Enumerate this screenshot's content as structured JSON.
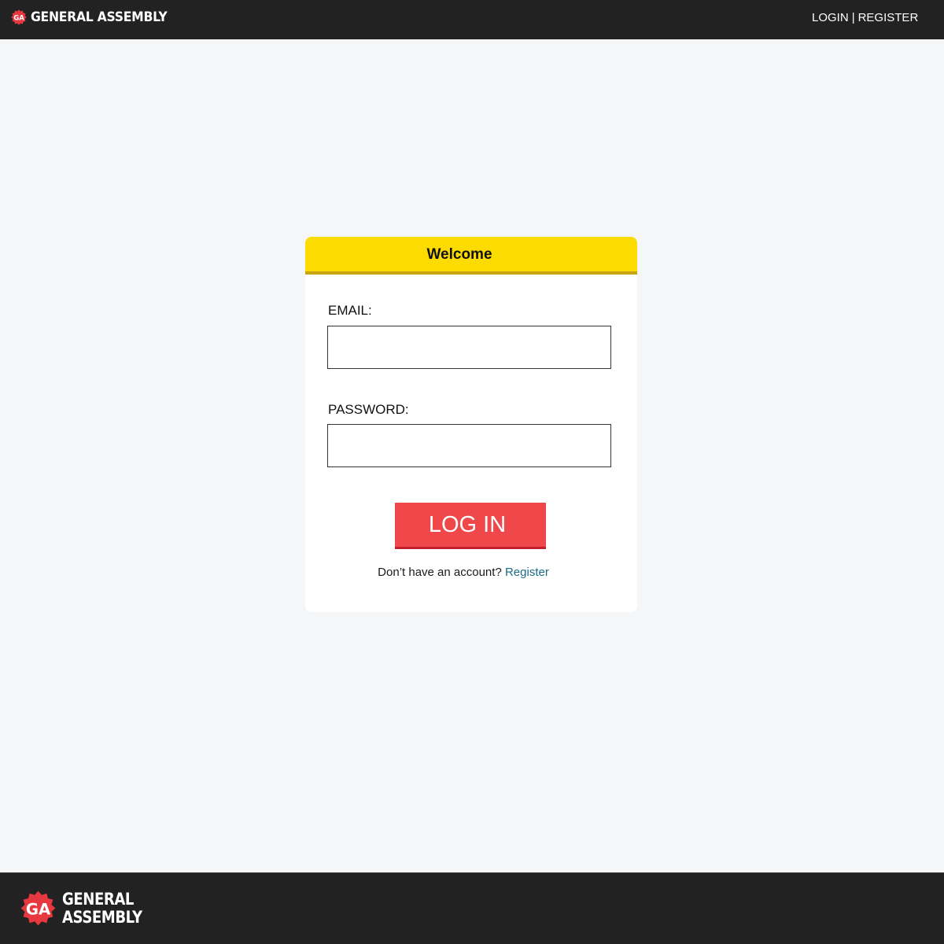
{
  "header": {
    "brand": {
      "seal_text": "GA",
      "wordmark": "GENERAL ASSEMBLY"
    },
    "login_link": "LOGIN",
    "separator": "|",
    "register_link": "REGISTER"
  },
  "login_card": {
    "title": "Welcome",
    "email_label": "EMAIL:",
    "email_value": "",
    "password_label": "PASSWORD:",
    "password_value": "",
    "submit_label": "LOG IN",
    "register_prompt": "Don’t have an account?",
    "register_link": "Register"
  },
  "footer": {
    "brand": {
      "seal_text": "GA",
      "line1": "GENERAL",
      "line2": "ASSEMBLY"
    }
  },
  "colors": {
    "topbar": "#222222",
    "page_background": "#f5f6f8",
    "card_header": "#fcdc00",
    "card_header_border": "#c8a60f",
    "button": "#f0474a",
    "button_border": "#c21f2a",
    "link": "#1b6b87",
    "brand_seal": "#e7373f"
  }
}
